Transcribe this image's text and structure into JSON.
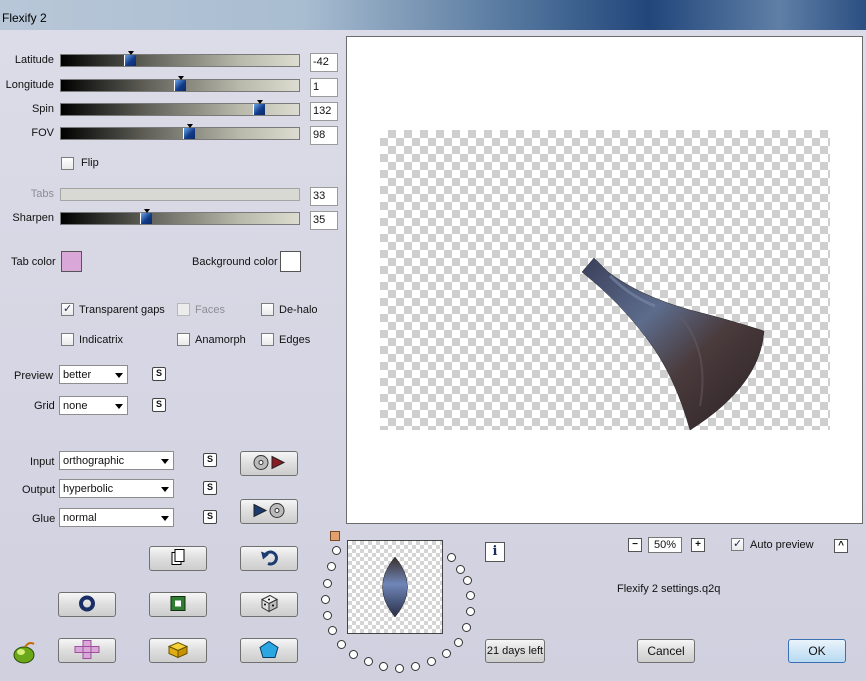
{
  "window": {
    "title": "Flexify 2"
  },
  "sliders": [
    {
      "label": "Latitude",
      "value": "-42",
      "level": 0.28,
      "disabled": false
    },
    {
      "label": "Longitude",
      "value": "1",
      "level": 0.5,
      "disabled": false
    },
    {
      "label": "Spin",
      "value": "132",
      "level": 0.85,
      "disabled": false
    },
    {
      "label": "FOV",
      "value": "98",
      "level": 0.54,
      "disabled": false
    }
  ],
  "flip": {
    "label": "Flip",
    "checked": false
  },
  "tabs": {
    "label": "Tabs",
    "value": "33",
    "disabled": true
  },
  "sharpen": {
    "label": "Sharpen",
    "value": "35",
    "level": 0.35
  },
  "tab_color": {
    "label": "Tab color",
    "color": "#d9a8d8"
  },
  "background_color": {
    "label": "Background color",
    "color": "#ffffff"
  },
  "options": {
    "transparent_gaps": {
      "label": "Transparent gaps",
      "checked": true
    },
    "faces": {
      "label": "Faces",
      "checked": false,
      "disabled": true
    },
    "de_halo": {
      "label": "De-halo",
      "checked": false
    },
    "indicatrix": {
      "label": "Indicatrix",
      "checked": false
    },
    "anamorph": {
      "label": "Anamorph",
      "checked": false
    },
    "edges": {
      "label": "Edges",
      "checked": false
    }
  },
  "preview_select": {
    "label": "Preview",
    "value": "better"
  },
  "grid_select": {
    "label": "Grid",
    "value": "none"
  },
  "input_select": {
    "label": "Input",
    "value": "orthographic"
  },
  "output_select": {
    "label": "Output",
    "value": "hyperbolic"
  },
  "glue_select": {
    "label": "Glue",
    "value": "normal"
  },
  "s_button_label": "S",
  "zoom": {
    "value": "50%",
    "minus": "−",
    "plus": "+"
  },
  "auto_preview": {
    "label": "Auto preview",
    "checked": true
  },
  "settings_file": "Flexify 2 settings.q2q",
  "trial_button": "21 days left",
  "cancel_button": "Cancel",
  "ok_button": "OK",
  "info_icon": "i",
  "collapse_icon": "^"
}
